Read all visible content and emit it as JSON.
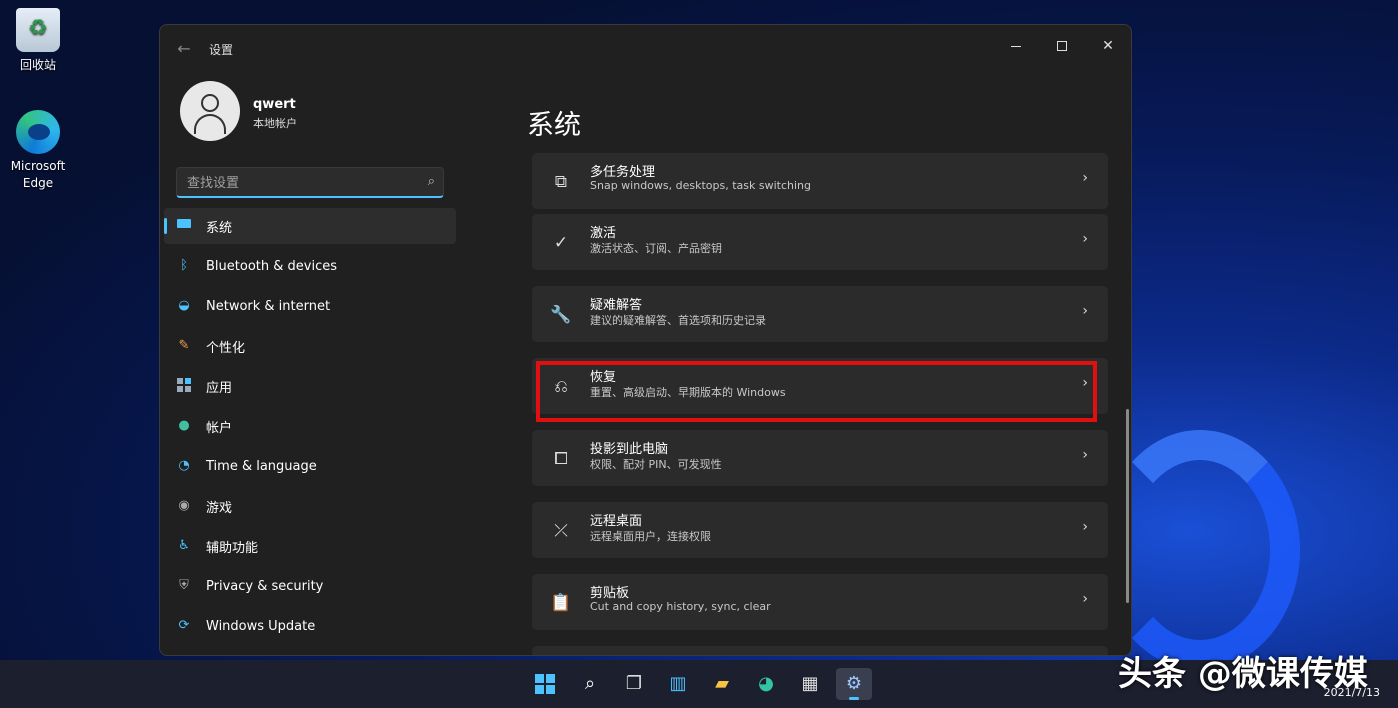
{
  "desktop": {
    "icons": [
      {
        "label": "回收站",
        "icon": "recycle-bin-icon"
      },
      {
        "label": "Microsoft Edge",
        "icon": "edge-icon"
      }
    ]
  },
  "window": {
    "title": "设置",
    "back_icon": "back-arrow-icon",
    "controls": [
      "minimize-icon",
      "maximize-icon",
      "close-icon"
    ]
  },
  "user": {
    "name": "qwert",
    "type": "本地帐户"
  },
  "search": {
    "placeholder": "查找设置",
    "value": ""
  },
  "nav": {
    "items": [
      {
        "label": "系统",
        "icon": "system-icon",
        "active": true
      },
      {
        "label": "Bluetooth & devices",
        "icon": "bluetooth-icon"
      },
      {
        "label": "Network & internet",
        "icon": "wifi-icon"
      },
      {
        "label": "个性化",
        "icon": "brush-icon"
      },
      {
        "label": "应用",
        "icon": "apps-icon"
      },
      {
        "label": "帐户",
        "icon": "account-icon"
      },
      {
        "label": "Time & language",
        "icon": "globe-clock-icon"
      },
      {
        "label": "游戏",
        "icon": "gamepad-icon"
      },
      {
        "label": "辅助功能",
        "icon": "accessibility-icon"
      },
      {
        "label": "Privacy & security",
        "icon": "shield-icon"
      },
      {
        "label": "Windows Update",
        "icon": "update-icon"
      }
    ]
  },
  "main": {
    "title": "系统",
    "cards": [
      {
        "title": "多任务处理",
        "subtitle": "Snap windows, desktops, task switching",
        "icon": "multitasking-icon"
      },
      {
        "title": "激活",
        "subtitle": "激活状态、订阅、产品密钥",
        "icon": "check-circle-icon"
      },
      {
        "title": "疑难解答",
        "subtitle": "建议的疑难解答、首选项和历史记录",
        "icon": "wrench-icon"
      },
      {
        "title": "恢复",
        "subtitle": "重置、高级启动、早期版本的 Windows",
        "icon": "recovery-icon",
        "highlighted": true
      },
      {
        "title": "投影到此电脑",
        "subtitle": "权限、配对 PIN、可发现性",
        "icon": "projection-icon"
      },
      {
        "title": "远程桌面",
        "subtitle": "远程桌面用户，连接权限",
        "icon": "remote-desktop-icon"
      },
      {
        "title": "剪贴板",
        "subtitle": "Cut and copy history, sync, clear",
        "icon": "clipboard-icon"
      }
    ]
  },
  "taskbar": {
    "items": [
      "start-icon",
      "search-icon",
      "task-view-icon",
      "widgets-icon",
      "file-explorer-icon",
      "edge-icon",
      "store-icon",
      "settings-icon"
    ],
    "active": "settings-icon",
    "date": "2021/7/13"
  },
  "watermark": "头条 @微课传媒",
  "colors": {
    "accent": "#4cc2ff",
    "highlight": "#e01010",
    "window_bg": "#202020",
    "card_bg": "#2b2b2b"
  }
}
